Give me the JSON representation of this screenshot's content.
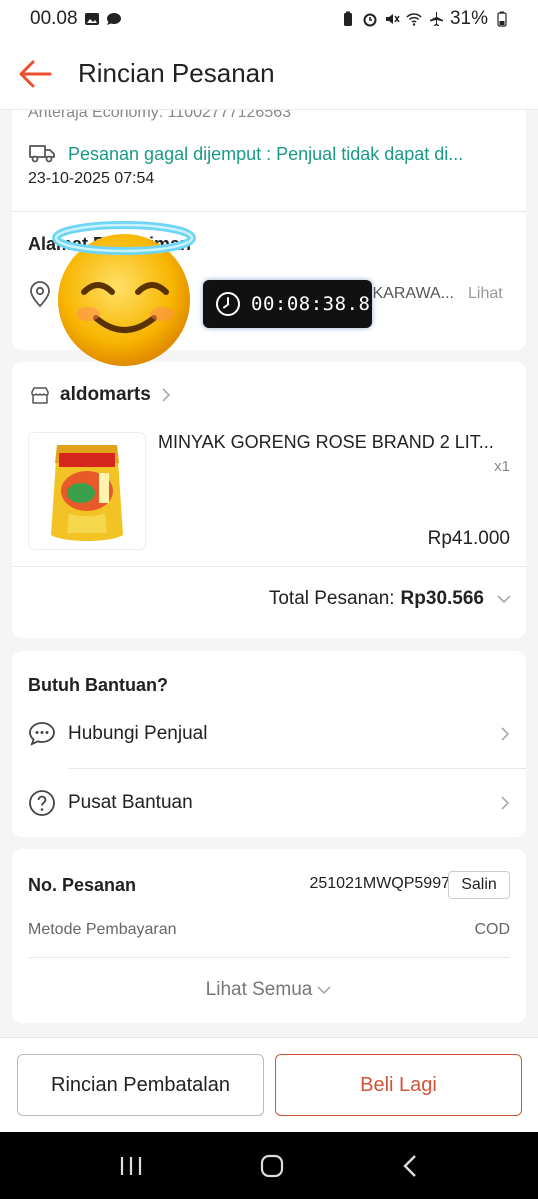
{
  "status_bar": {
    "time": "00.08",
    "battery": "31%"
  },
  "header": {
    "title": "Rincian Pesanan"
  },
  "shipping": {
    "courier_line": "Anteraja Economy: 11002777126563",
    "status_text": "Pesanan gagal dijemput : Penjual tidak dapat di...",
    "status_time": "23-10-2025 07:54"
  },
  "address": {
    "title": "Alamat Pengiriman",
    "text": "a                         KARAWA...",
    "link": "Lihat"
  },
  "order_item": {
    "shop_name": "aldomarts",
    "product_name": "MINYAK GORENG ROSE BRAND 2 LIT...",
    "quantity": "x1",
    "price": "Rp41.000",
    "total_label": "Total Pesanan:",
    "total_value": "Rp30.566"
  },
  "help": {
    "title": "Butuh Bantuan?",
    "contact_seller": "Hubungi Penjual",
    "help_center": "Pusat Bantuan"
  },
  "order_info": {
    "order_no_label": "No. Pesanan",
    "order_no": "251021MWQP5997",
    "copy_label": "Salin",
    "payment_label": "Metode Pembayaran",
    "payment_value": "COD",
    "see_all": "Lihat Semua"
  },
  "actions": {
    "cancel_details": "Rincian Pembatalan",
    "buy_again": "Beli Lagi"
  },
  "overlay": {
    "timer": "00:08:38.8"
  },
  "colors": {
    "accent": "#ee4d2d",
    "teal": "#1a9a86",
    "button_outline": "#d0543a"
  }
}
